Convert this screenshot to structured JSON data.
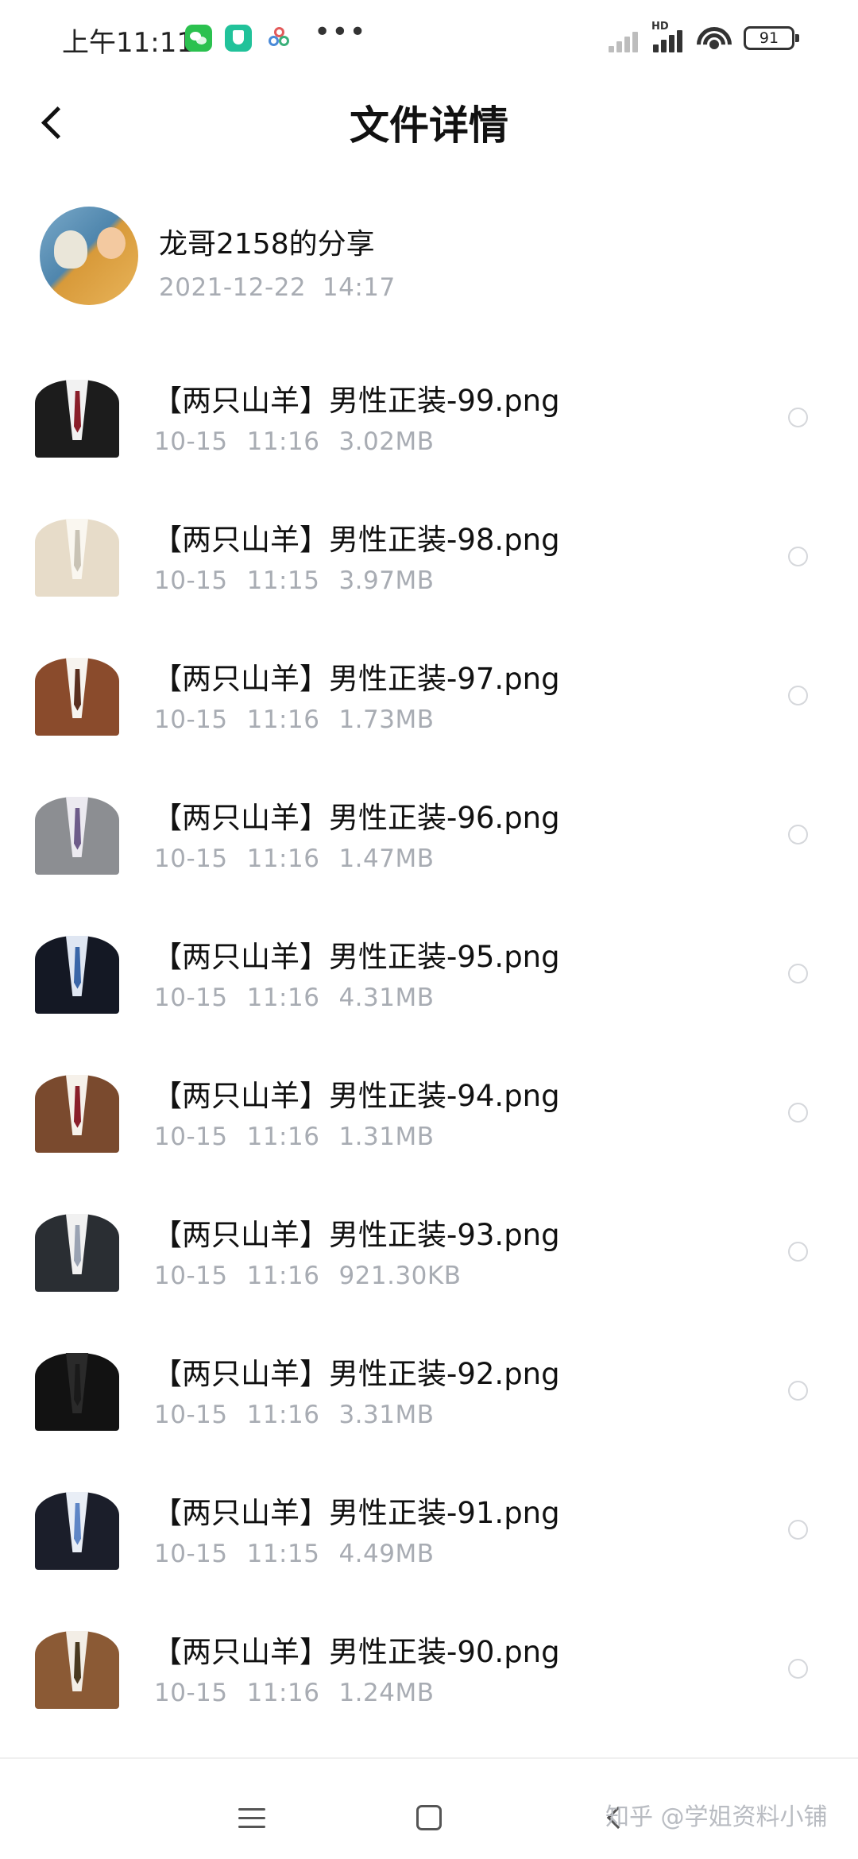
{
  "status_bar": {
    "time": "上午11:11",
    "more": "•••",
    "network": "HD",
    "battery": "91",
    "icons": [
      "wechat-icon",
      "shield-app-icon",
      "clover-app-icon",
      "signal-icon",
      "wifi-icon",
      "battery-icon"
    ]
  },
  "header": {
    "title": "文件详情",
    "back_icon": "chevron-left-icon"
  },
  "share": {
    "name": "龙哥2158的分享",
    "date": "2021-12-22",
    "time": "14:17"
  },
  "files": [
    {
      "name": "【两只山羊】男性正装-99.png",
      "date": "10-15",
      "time": "11:16",
      "size": "3.02MB",
      "suit": "#1c1c1c",
      "shirt": "#f2f2f2",
      "tie": "#8a1f2a"
    },
    {
      "name": "【两只山羊】男性正装-98.png",
      "date": "10-15",
      "time": "11:15",
      "size": "3.97MB",
      "suit": "#e7dcc9",
      "shirt": "#faf7f0",
      "tie": "#c9c3b5"
    },
    {
      "name": "【两只山羊】男性正装-97.png",
      "date": "10-15",
      "time": "11:16",
      "size": "1.73MB",
      "suit": "#8a4b2c",
      "shirt": "#f7f4ef",
      "tie": "#5a3020"
    },
    {
      "name": "【两只山羊】男性正装-96.png",
      "date": "10-15",
      "time": "11:16",
      "size": "1.47MB",
      "suit": "#8c8e92",
      "shirt": "#eceaf0",
      "tie": "#6e5c8a"
    },
    {
      "name": "【两只山羊】男性正装-95.png",
      "date": "10-15",
      "time": "11:16",
      "size": "4.31MB",
      "suit": "#141824",
      "shirt": "#dfe6f2",
      "tie": "#3a66a8"
    },
    {
      "name": "【两只山羊】男性正装-94.png",
      "date": "10-15",
      "time": "11:16",
      "size": "1.31MB",
      "suit": "#7a4a2e",
      "shirt": "#f6f1ea",
      "tie": "#8a1f2a"
    },
    {
      "name": "【两只山羊】男性正装-93.png",
      "date": "10-15",
      "time": "11:16",
      "size": "921.30KB",
      "suit": "#2a2e33",
      "shirt": "#f1f1f1",
      "tie": "#9aa3b3"
    },
    {
      "name": "【两只山羊】男性正装-92.png",
      "date": "10-15",
      "time": "11:16",
      "size": "3.31MB",
      "suit": "#121212",
      "shirt": "#2a2a2a",
      "tie": "#1a1a1a"
    },
    {
      "name": "【两只山羊】男性正装-91.png",
      "date": "10-15",
      "time": "11:15",
      "size": "4.49MB",
      "suit": "#1b1e2a",
      "shirt": "#e9eef6",
      "tie": "#5f86c6"
    },
    {
      "name": "【两只山羊】男性正装-90.png",
      "date": "10-15",
      "time": "11:16",
      "size": "1.24MB",
      "suit": "#8b5a35",
      "shirt": "#f3eee6",
      "tie": "#4a3a20"
    }
  ],
  "nav": {
    "icons": [
      "menu-icon",
      "home-square-icon",
      "back-chevron-icon"
    ]
  },
  "watermark": "知乎 @学姐资料小铺"
}
